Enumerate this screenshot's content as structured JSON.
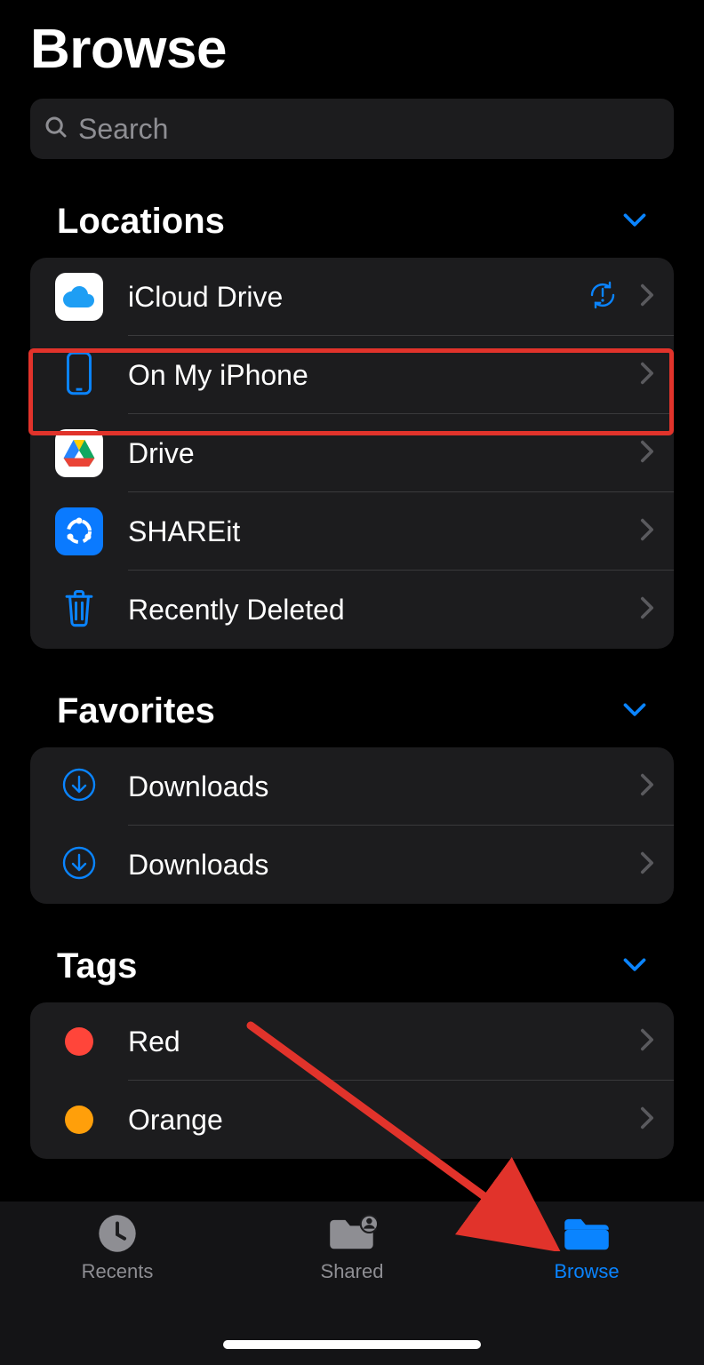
{
  "header": {
    "title": "Browse"
  },
  "search": {
    "placeholder": "Search"
  },
  "sections": {
    "locations": {
      "title": "Locations",
      "items": [
        {
          "label": "iCloud Drive"
        },
        {
          "label": "On My iPhone"
        },
        {
          "label": "Drive"
        },
        {
          "label": "SHAREit"
        },
        {
          "label": "Recently Deleted"
        }
      ]
    },
    "favorites": {
      "title": "Favorites",
      "items": [
        {
          "label": "Downloads"
        },
        {
          "label": "Downloads"
        }
      ]
    },
    "tags": {
      "title": "Tags",
      "items": [
        {
          "label": "Red",
          "color": "#ff453a"
        },
        {
          "label": "Orange",
          "color": "#ff9f0a"
        }
      ]
    }
  },
  "tabbar": {
    "items": [
      {
        "label": "Recents",
        "active": false
      },
      {
        "label": "Shared",
        "active": false
      },
      {
        "label": "Browse",
        "active": true
      }
    ]
  },
  "accent_color": "#0a84ff"
}
